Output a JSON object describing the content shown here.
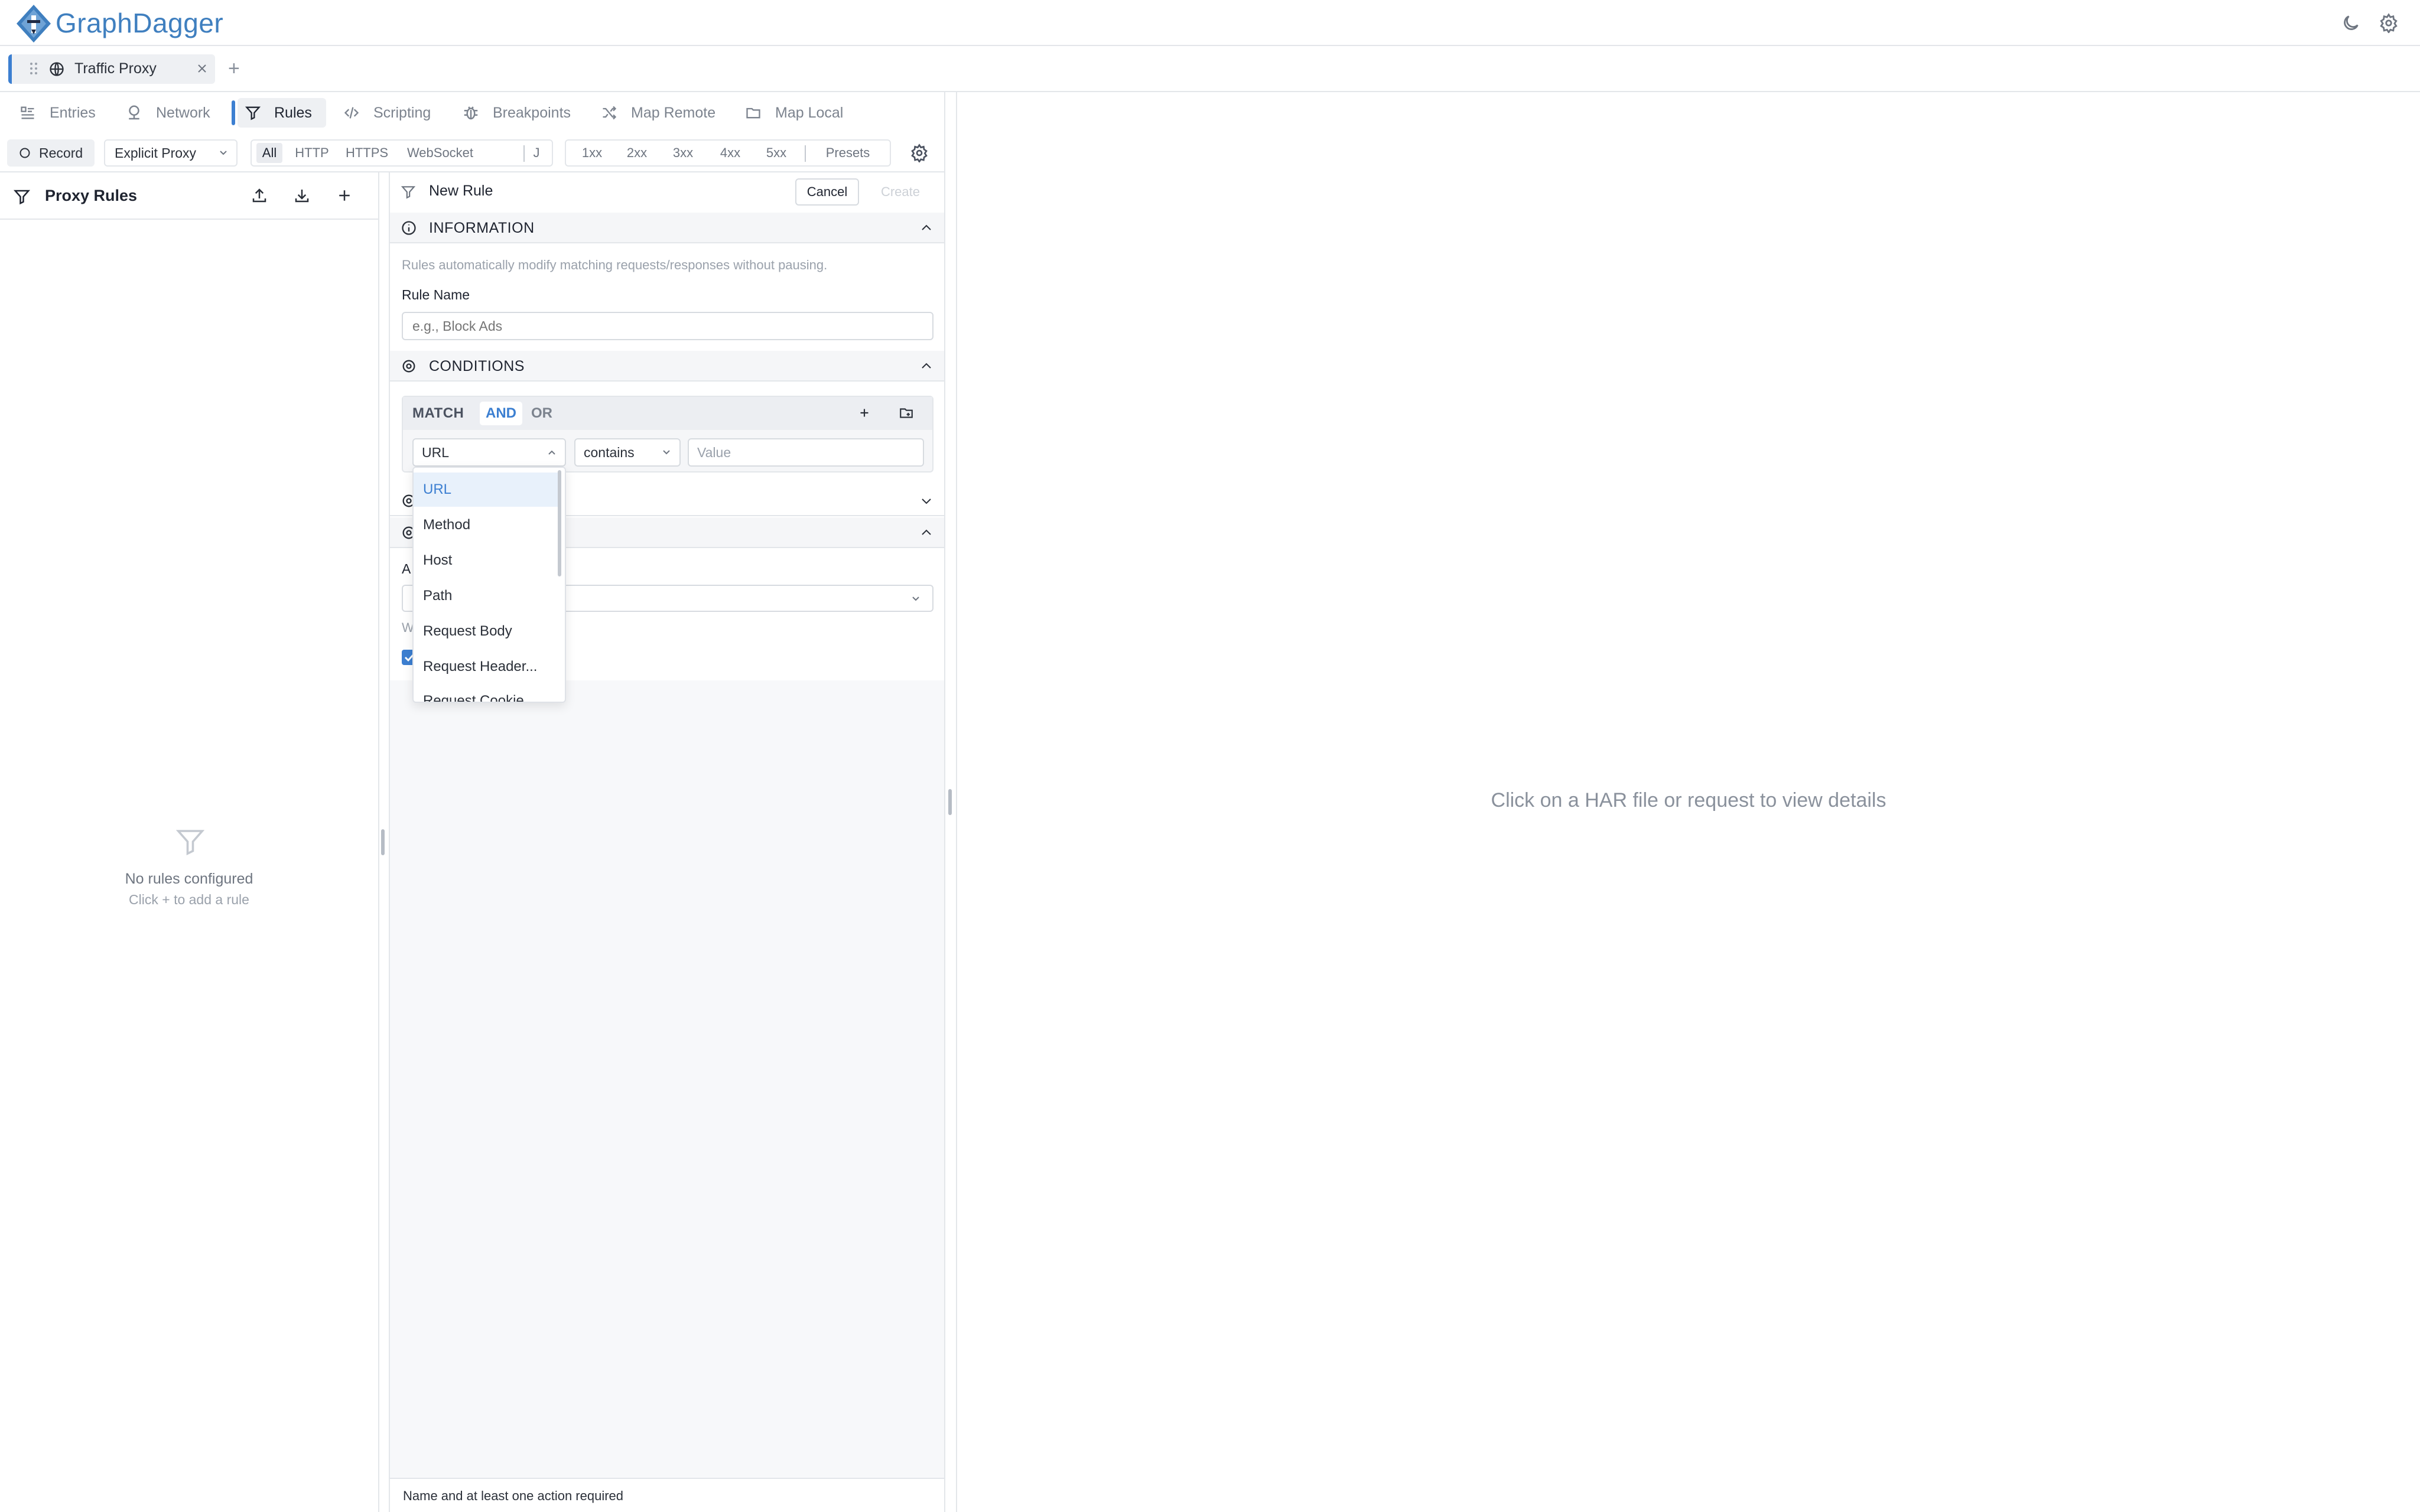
{
  "app": {
    "brand": "GraphDagger"
  },
  "session_tabs": [
    {
      "label": "Traffic Proxy"
    }
  ],
  "tool_tabs": [
    {
      "label": "Entries",
      "icon": "list-icon"
    },
    {
      "label": "Network",
      "icon": "network-icon"
    },
    {
      "label": "Rules",
      "icon": "funnel-icon",
      "active": true
    },
    {
      "label": "Scripting",
      "icon": "code-icon"
    },
    {
      "label": "Breakpoints",
      "icon": "bug-icon"
    },
    {
      "label": "Map Remote",
      "icon": "shuffle-icon"
    },
    {
      "label": "Map Local",
      "icon": "folder-icon"
    }
  ],
  "toolbar": {
    "record": "Record",
    "proxy_mode": "Explicit Proxy",
    "protocols": [
      "All",
      "HTTP",
      "HTTPS",
      "WebSocket",
      "J"
    ],
    "protocol_selected": "All",
    "status_codes": [
      "1xx",
      "2xx",
      "3xx",
      "4xx",
      "5xx"
    ],
    "presets": "Presets"
  },
  "left_panel": {
    "title": "Proxy Rules",
    "empty_title": "No rules configured",
    "empty_hint": "Click + to add a rule"
  },
  "editor": {
    "title": "New Rule",
    "cancel": "Cancel",
    "create": "Create",
    "information": {
      "heading": "INFORMATION",
      "description": "Rules automatically modify matching requests/responses without pausing.",
      "rule_name_label": "Rule Name",
      "rule_name_placeholder": "e.g., Block Ads"
    },
    "conditions": {
      "heading": "CONDITIONS",
      "match_label": "MATCH",
      "and": "AND",
      "or": "OR",
      "field_value": "URL",
      "operator_value": "contains",
      "value_placeholder": "Value"
    },
    "partial_labels": {
      "a": "A",
      "w": "W"
    },
    "footer": "Name and at least one action required"
  },
  "dropdown": {
    "items": [
      "URL",
      "Method",
      "Host",
      "Path",
      "Request Body",
      "Request Header...",
      "Request Cookie..."
    ],
    "selected": "URL"
  },
  "right_panel": {
    "message": "Click on a HAR file or request to view details"
  },
  "colors": {
    "accent": "#3c7fd1",
    "brand": "#3f7fbf",
    "muted": "#8a919c",
    "border": "#e3e6ea"
  }
}
